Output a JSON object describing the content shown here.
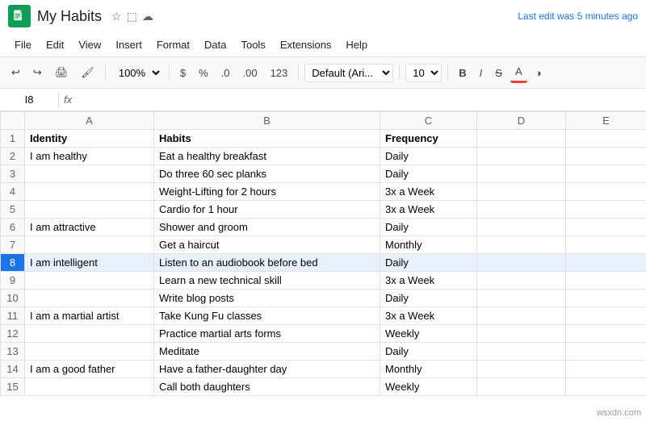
{
  "titleBar": {
    "title": "My Habits",
    "lastEdit": "Last edit was 5 minutes ago"
  },
  "menuBar": {
    "items": [
      "File",
      "Edit",
      "View",
      "Insert",
      "Format",
      "Data",
      "Tools",
      "Extensions",
      "Help"
    ]
  },
  "toolbar": {
    "zoom": "100%",
    "currency": "$",
    "percent": "%",
    "decimal0": ".0",
    "decimal00": ".00",
    "more": "123",
    "font": "Default (Ari...",
    "fontSize": "10",
    "bold": "B",
    "italic": "I",
    "strikethrough": "S",
    "underline": "A"
  },
  "formulaBar": {
    "cellRef": "I8",
    "fxLabel": "fx"
  },
  "columns": {
    "rowNum": "",
    "A": "A",
    "B": "B",
    "C": "C",
    "D": "D",
    "E": "E"
  },
  "rows": [
    {
      "num": "1",
      "A": "Identity",
      "B": "Habits",
      "C": "Frequency",
      "D": "",
      "E": "",
      "isHeader": true
    },
    {
      "num": "2",
      "A": "I am healthy",
      "B": "Eat a healthy breakfast",
      "C": "Daily",
      "D": "",
      "E": ""
    },
    {
      "num": "3",
      "A": "",
      "B": "Do three 60 sec planks",
      "C": "Daily",
      "D": "",
      "E": ""
    },
    {
      "num": "4",
      "A": "",
      "B": "Weight-Lifting for 2 hours",
      "C": "3x a Week",
      "D": "",
      "E": ""
    },
    {
      "num": "5",
      "A": "",
      "B": "Cardio for 1 hour",
      "C": "3x a Week",
      "D": "",
      "E": ""
    },
    {
      "num": "6",
      "A": "I am attractive",
      "B": "Shower and groom",
      "C": "Daily",
      "D": "",
      "E": ""
    },
    {
      "num": "7",
      "A": "",
      "B": "Get a haircut",
      "C": "Monthly",
      "D": "",
      "E": ""
    },
    {
      "num": "8",
      "A": "I am intelligent",
      "B": "Listen to an audiobook before bed",
      "C": "Daily",
      "D": "",
      "E": "",
      "selected": true
    },
    {
      "num": "9",
      "A": "",
      "B": "Learn a new technical skill",
      "C": "3x a Week",
      "D": "",
      "E": ""
    },
    {
      "num": "10",
      "A": "",
      "B": "Write blog posts",
      "C": "Daily",
      "D": "",
      "E": ""
    },
    {
      "num": "11",
      "A": "I am a martial artist",
      "B": "Take Kung Fu classes",
      "C": "3x a Week",
      "D": "",
      "E": ""
    },
    {
      "num": "12",
      "A": "",
      "B": "Practice martial arts forms",
      "C": "Weekly",
      "D": "",
      "E": ""
    },
    {
      "num": "13",
      "A": "",
      "B": "Meditate",
      "C": "Daily",
      "D": "",
      "E": ""
    },
    {
      "num": "14",
      "A": "I am a good father",
      "B": "Have a father-daughter day",
      "C": "Monthly",
      "D": "",
      "E": ""
    },
    {
      "num": "15",
      "A": "",
      "B": "Call both daughters",
      "C": "Weekly",
      "D": "",
      "E": ""
    }
  ],
  "watermark": "wsxdn.com"
}
